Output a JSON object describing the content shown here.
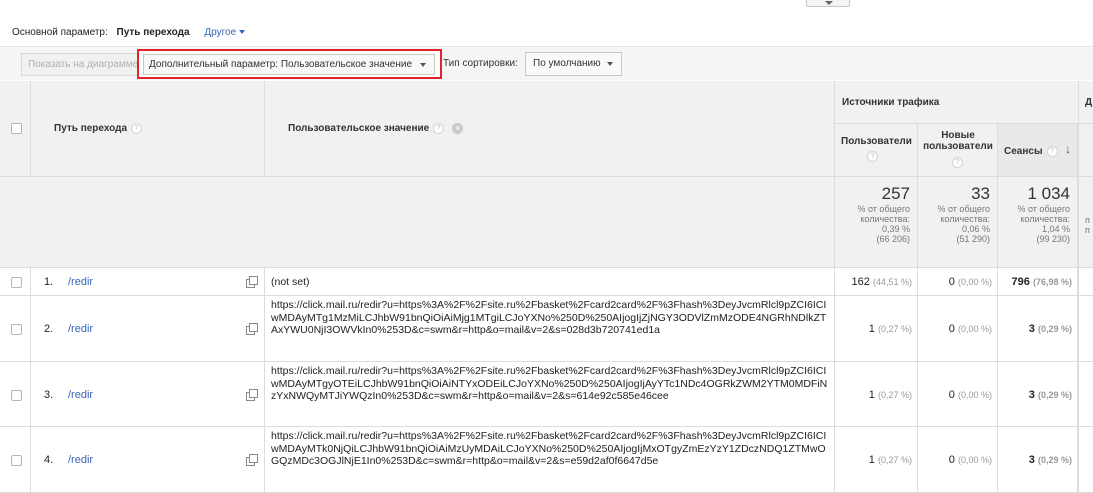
{
  "dimensions": {
    "label": "Основной параметр:",
    "current": "Путь перехода",
    "other": "Другое"
  },
  "toolbar": {
    "chart_button": "Показать на диаграмме",
    "secondary_dimension": "Дополнительный параметр: Пользовательское значение",
    "sort_label": "Тип сортировки:",
    "sort_value": "По умолчанию"
  },
  "headers": {
    "path": "Путь перехода",
    "custom_value": "Пользовательское значение",
    "group": "Источники трафика",
    "users": "Пользователи",
    "new_users": "Новые пользователи",
    "sessions": "Сеансы",
    "help_glyph": "?",
    "remove_glyph": "✕",
    "sort_glyph": "↓",
    "next_group_cut": "Д"
  },
  "totals": {
    "users": {
      "value": "257",
      "line1": "% от общего",
      "line2": "количества:",
      "line3": "0,39 %",
      "line4": "(66 206)"
    },
    "new_users": {
      "value": "33",
      "line1": "% от общего",
      "line2": "количества:",
      "line3": "0,06 %",
      "line4": "(51 290)"
    },
    "sessions": {
      "value": "1 034",
      "line1": "% от общего",
      "line2": "количества:",
      "line3": "1,04 %",
      "line4": "(99 230)"
    },
    "cut1": "п",
    "cut2": "п"
  },
  "rows": [
    {
      "num": "1.",
      "path": "/redir",
      "value": "(not set)",
      "users": "162",
      "users_pct": "(44,51 %)",
      "new_users": "0",
      "new_pct": "(0,00 %)",
      "sessions": "796",
      "sessions_pct": "(76,98 %)"
    },
    {
      "num": "2.",
      "path": "/redir",
      "value": "https://click.mail.ru/redir?u=https%3A%2F%2Fsite.ru%2Fbasket%2Fcard2card%2F%3Fhash%3DeyJvcmRlcl9pZCI6ICIwMDAyMTg1MzMiLCJhbW91bnQiOiAiMjg1MTgiLCJoYXNo%250D%250AIjogIjZjNGY3ODVlZmMzODE4NGRhNDlkZTAxYWU0NjI3OWVkIn0%253D&c=swm&r=http&o=mail&v=2&s=028d3b720741ed1a",
      "users": "1",
      "users_pct": "(0,27 %)",
      "new_users": "0",
      "new_pct": "(0,00 %)",
      "sessions": "3",
      "sessions_pct": "(0,29 %)"
    },
    {
      "num": "3.",
      "path": "/redir",
      "value": "https://click.mail.ru/redir?u=https%3A%2F%2Fsite.ru%2Fbasket%2Fcard2card%2F%3Fhash%3DeyJvcmRlcl9pZCI6ICIwMDAyMTgyOTEiLCJhbW91bnQiOiAiNTYxODEiLCJoYXNo%250D%250AIjogIjAyYTc1NDc4OGRkZWM2YTM0MDFiNzYxNWQyMTJiYWQzIn0%253D&c=swm&r=http&o=mail&v=2&s=614e92c585e46cee",
      "users": "1",
      "users_pct": "(0,27 %)",
      "new_users": "0",
      "new_pct": "(0,00 %)",
      "sessions": "3",
      "sessions_pct": "(0,29 %)"
    },
    {
      "num": "4.",
      "path": "/redir",
      "value": "https://click.mail.ru/redir?u=https%3A%2F%2Fsite.ru%2Fbasket%2Fcard2card%2F%3Fhash%3DeyJvcmRlcl9pZCI6ICIwMDAyMTk0NjQiLCJhbW91bnQiOiAiMzUyMDAiLCJoYXNo%250D%250AIjogIjMxOTgyZmEzYzY1ZDczNDQ1ZTMwOGQzMDc3OGJlNjE1In0%253D&c=swm&r=http&o=mail&v=2&s=e59d2af0f6647d5e",
      "users": "1",
      "users_pct": "(0,27 %)",
      "new_users": "0",
      "new_pct": "(0,00 %)",
      "sessions": "3",
      "sessions_pct": "(0,29 %)"
    }
  ]
}
